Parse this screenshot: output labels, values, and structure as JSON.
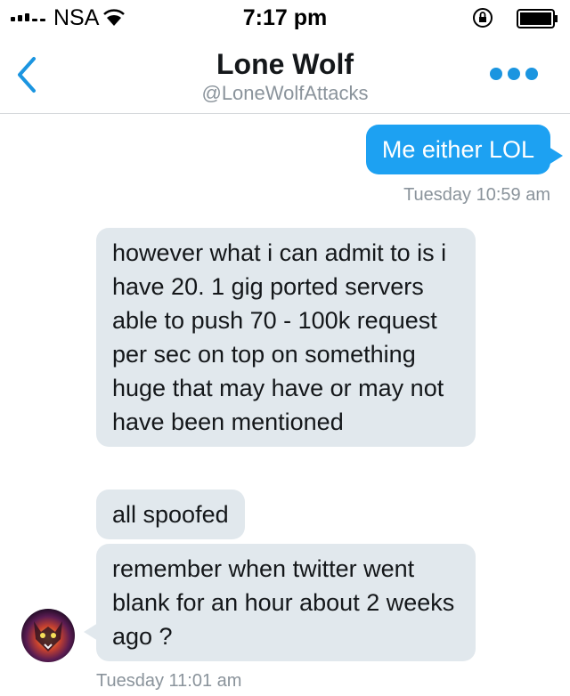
{
  "status_bar": {
    "carrier": "NSA",
    "time": "7:17 pm"
  },
  "header": {
    "title": "Lone Wolf",
    "handle": "@LoneWolfAttacks"
  },
  "messages": [
    {
      "direction": "sent",
      "text": "Me either LOL"
    },
    {
      "direction": "received",
      "text": "however what i can admit to is i have 20. 1 gig ported servers able to push 70 - 100k request per sec on top on something huge that may have or may not have been mentioned"
    },
    {
      "direction": "received",
      "text": "all spoofed"
    },
    {
      "direction": "received",
      "text": "remember when twitter went blank for an hour about 2 weeks ago ?"
    }
  ],
  "timestamps": [
    "Tuesday 10:59 am",
    "Tuesday 11:01 am"
  ],
  "colors": {
    "accent": "#1da1f2",
    "received_bubble": "#e1e8ed",
    "muted_text": "#8a939b"
  },
  "icons": [
    "signal-icon",
    "wifi-icon",
    "orientation-lock-icon",
    "battery-icon",
    "back-chevron-icon",
    "more-icon"
  ]
}
